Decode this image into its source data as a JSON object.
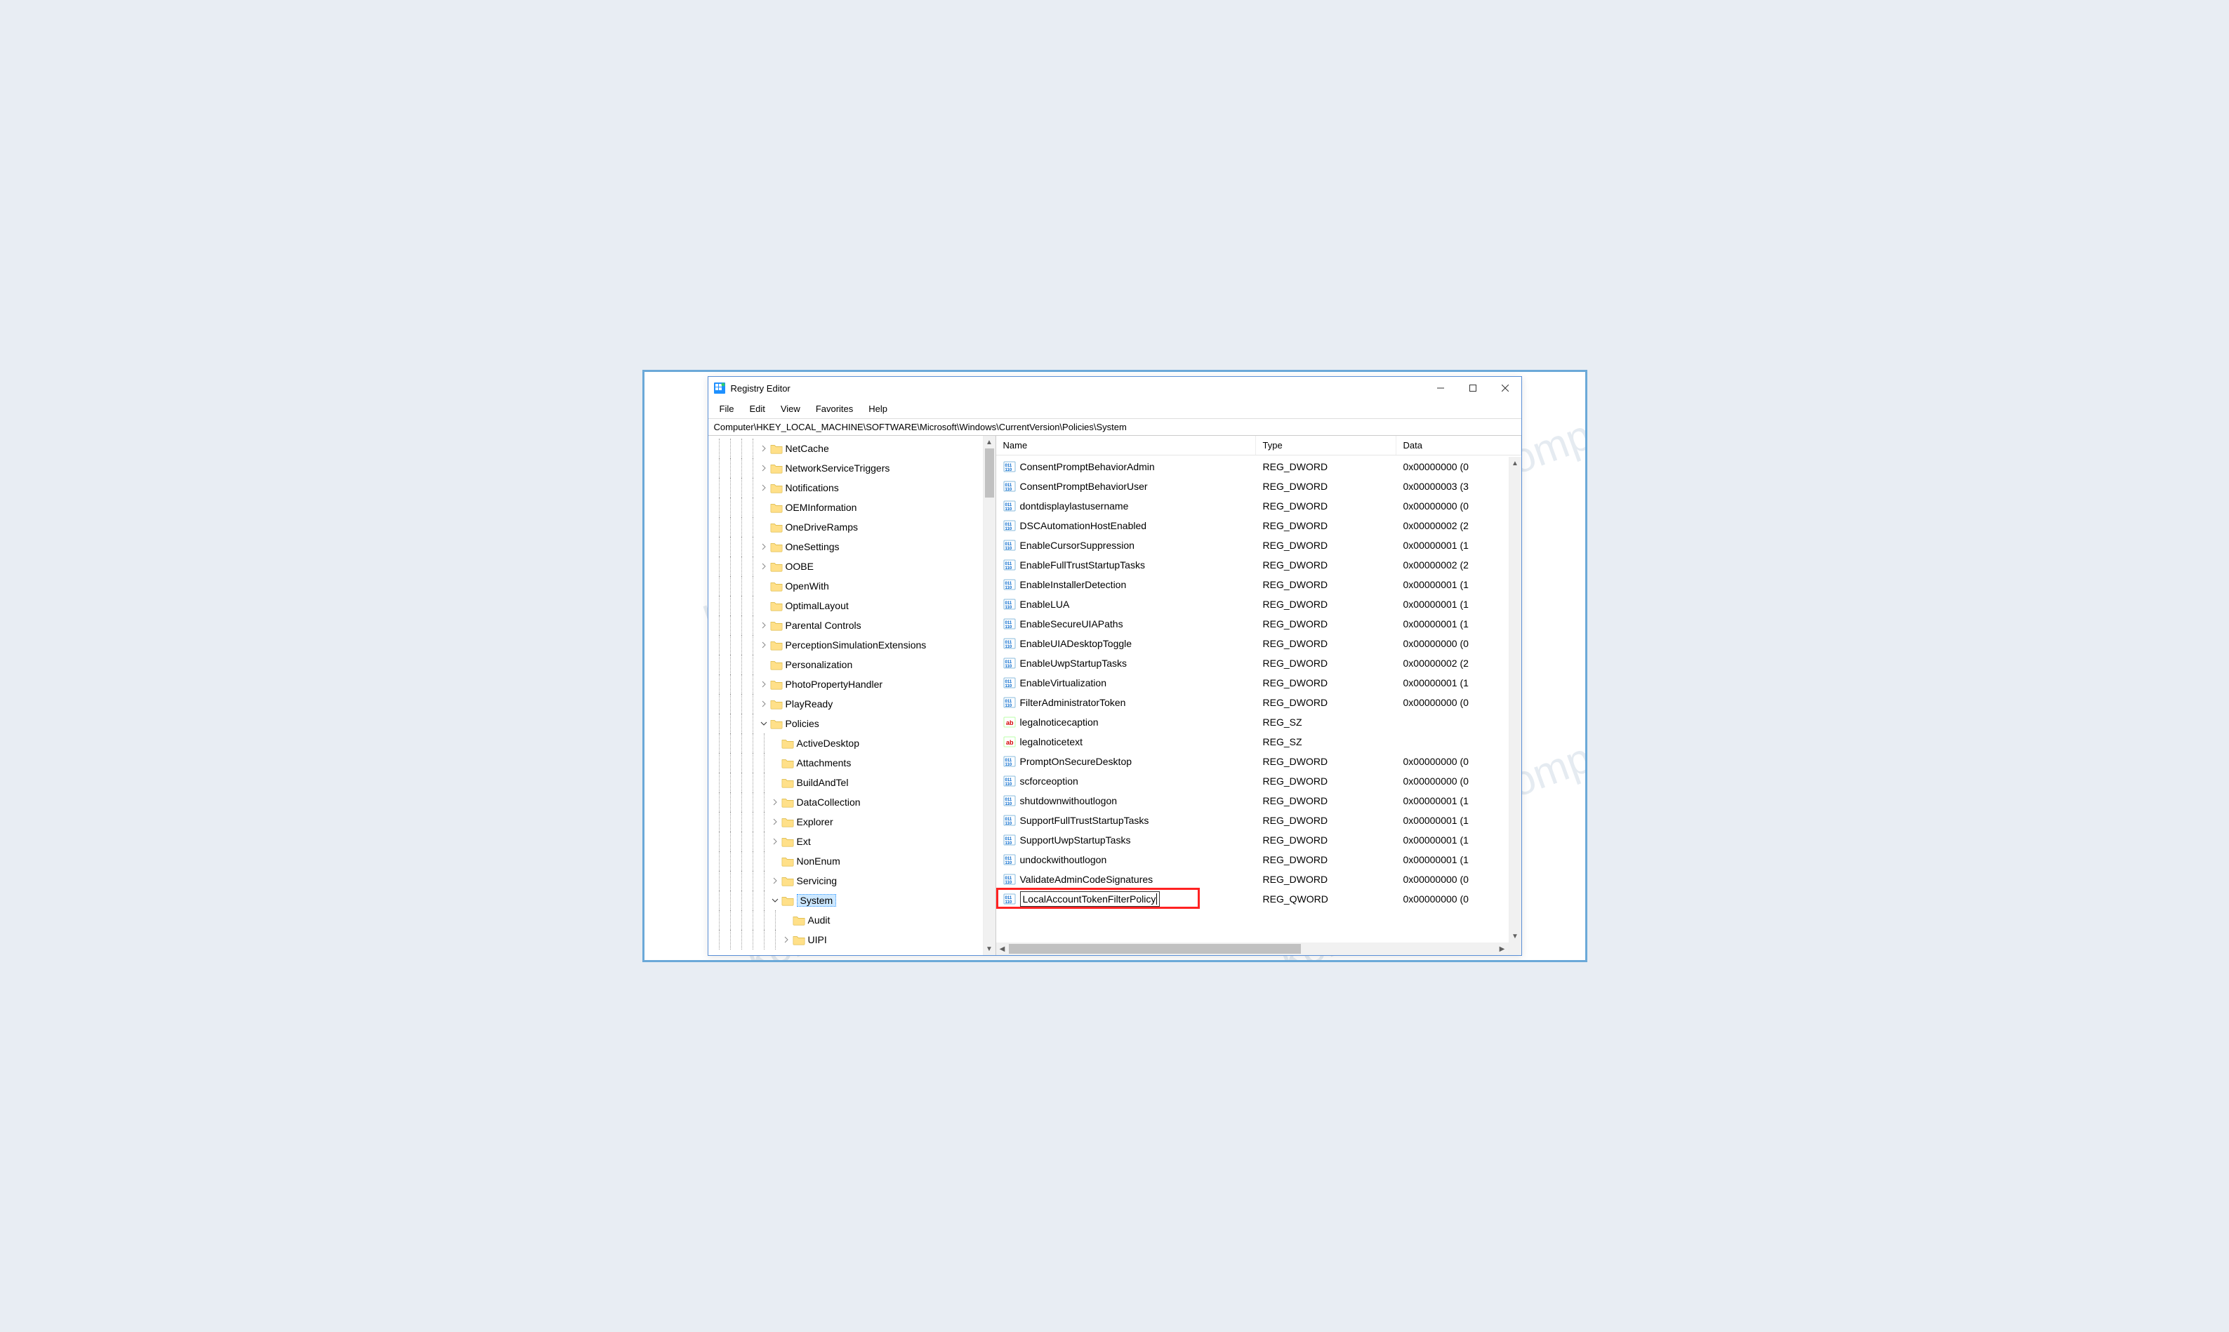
{
  "window": {
    "title": "Registry Editor",
    "path": "Computer\\HKEY_LOCAL_MACHINE\\SOFTWARE\\Microsoft\\Windows\\CurrentVersion\\Policies\\System"
  },
  "menu": [
    "File",
    "Edit",
    "View",
    "Favorites",
    "Help"
  ],
  "tree": [
    {
      "label": "NetCache",
      "depth": 4,
      "expander": "closed"
    },
    {
      "label": "NetworkServiceTriggers",
      "depth": 4,
      "expander": "closed"
    },
    {
      "label": "Notifications",
      "depth": 4,
      "expander": "closed"
    },
    {
      "label": "OEMInformation",
      "depth": 4,
      "expander": "none"
    },
    {
      "label": "OneDriveRamps",
      "depth": 4,
      "expander": "none"
    },
    {
      "label": "OneSettings",
      "depth": 4,
      "expander": "closed"
    },
    {
      "label": "OOBE",
      "depth": 4,
      "expander": "closed"
    },
    {
      "label": "OpenWith",
      "depth": 4,
      "expander": "none"
    },
    {
      "label": "OptimalLayout",
      "depth": 4,
      "expander": "none"
    },
    {
      "label": "Parental Controls",
      "depth": 4,
      "expander": "closed"
    },
    {
      "label": "PerceptionSimulationExtensions",
      "depth": 4,
      "expander": "closed"
    },
    {
      "label": "Personalization",
      "depth": 4,
      "expander": "none"
    },
    {
      "label": "PhotoPropertyHandler",
      "depth": 4,
      "expander": "closed"
    },
    {
      "label": "PlayReady",
      "depth": 4,
      "expander": "closed"
    },
    {
      "label": "Policies",
      "depth": 4,
      "expander": "open"
    },
    {
      "label": "ActiveDesktop",
      "depth": 5,
      "expander": "none"
    },
    {
      "label": "Attachments",
      "depth": 5,
      "expander": "none"
    },
    {
      "label": "BuildAndTel",
      "depth": 5,
      "expander": "none"
    },
    {
      "label": "DataCollection",
      "depth": 5,
      "expander": "closed"
    },
    {
      "label": "Explorer",
      "depth": 5,
      "expander": "closed"
    },
    {
      "label": "Ext",
      "depth": 5,
      "expander": "closed"
    },
    {
      "label": "NonEnum",
      "depth": 5,
      "expander": "none"
    },
    {
      "label": "Servicing",
      "depth": 5,
      "expander": "closed"
    },
    {
      "label": "System",
      "depth": 5,
      "expander": "open",
      "selected": true
    },
    {
      "label": "Audit",
      "depth": 6,
      "expander": "none"
    },
    {
      "label": "UIPI",
      "depth": 6,
      "expander": "closed"
    }
  ],
  "columns": {
    "name": "Name",
    "type": "Type",
    "data": "Data"
  },
  "values": [
    {
      "name": "ConsentPromptBehaviorAdmin",
      "type": "REG_DWORD",
      "data": "0x00000000 (0",
      "icon": "num"
    },
    {
      "name": "ConsentPromptBehaviorUser",
      "type": "REG_DWORD",
      "data": "0x00000003 (3",
      "icon": "num"
    },
    {
      "name": "dontdisplaylastusername",
      "type": "REG_DWORD",
      "data": "0x00000000 (0",
      "icon": "num"
    },
    {
      "name": "DSCAutomationHostEnabled",
      "type": "REG_DWORD",
      "data": "0x00000002 (2",
      "icon": "num"
    },
    {
      "name": "EnableCursorSuppression",
      "type": "REG_DWORD",
      "data": "0x00000001 (1",
      "icon": "num"
    },
    {
      "name": "EnableFullTrustStartupTasks",
      "type": "REG_DWORD",
      "data": "0x00000002 (2",
      "icon": "num"
    },
    {
      "name": "EnableInstallerDetection",
      "type": "REG_DWORD",
      "data": "0x00000001 (1",
      "icon": "num"
    },
    {
      "name": "EnableLUA",
      "type": "REG_DWORD",
      "data": "0x00000001 (1",
      "icon": "num"
    },
    {
      "name": "EnableSecureUIAPaths",
      "type": "REG_DWORD",
      "data": "0x00000001 (1",
      "icon": "num"
    },
    {
      "name": "EnableUIADesktopToggle",
      "type": "REG_DWORD",
      "data": "0x00000000 (0",
      "icon": "num"
    },
    {
      "name": "EnableUwpStartupTasks",
      "type": "REG_DWORD",
      "data": "0x00000002 (2",
      "icon": "num"
    },
    {
      "name": "EnableVirtualization",
      "type": "REG_DWORD",
      "data": "0x00000001 (1",
      "icon": "num"
    },
    {
      "name": "FilterAdministratorToken",
      "type": "REG_DWORD",
      "data": "0x00000000 (0",
      "icon": "num"
    },
    {
      "name": "legalnoticecaption",
      "type": "REG_SZ",
      "data": "",
      "icon": "str"
    },
    {
      "name": "legalnoticetext",
      "type": "REG_SZ",
      "data": "",
      "icon": "str"
    },
    {
      "name": "PromptOnSecureDesktop",
      "type": "REG_DWORD",
      "data": "0x00000000 (0",
      "icon": "num"
    },
    {
      "name": "scforceoption",
      "type": "REG_DWORD",
      "data": "0x00000000 (0",
      "icon": "num"
    },
    {
      "name": "shutdownwithoutlogon",
      "type": "REG_DWORD",
      "data": "0x00000001 (1",
      "icon": "num"
    },
    {
      "name": "SupportFullTrustStartupTasks",
      "type": "REG_DWORD",
      "data": "0x00000001 (1",
      "icon": "num"
    },
    {
      "name": "SupportUwpStartupTasks",
      "type": "REG_DWORD",
      "data": "0x00000001 (1",
      "icon": "num"
    },
    {
      "name": "undockwithoutlogon",
      "type": "REG_DWORD",
      "data": "0x00000001 (1",
      "icon": "num"
    },
    {
      "name": "ValidateAdminCodeSignatures",
      "type": "REG_DWORD",
      "data": "0x00000000 (0",
      "icon": "num"
    },
    {
      "name": "LocalAccountTokenFilterPolicy",
      "type": "REG_QWORD",
      "data": "0x00000000 (0",
      "icon": "num",
      "rename": true,
      "highlight": true
    }
  ],
  "watermark": "kompiwin"
}
